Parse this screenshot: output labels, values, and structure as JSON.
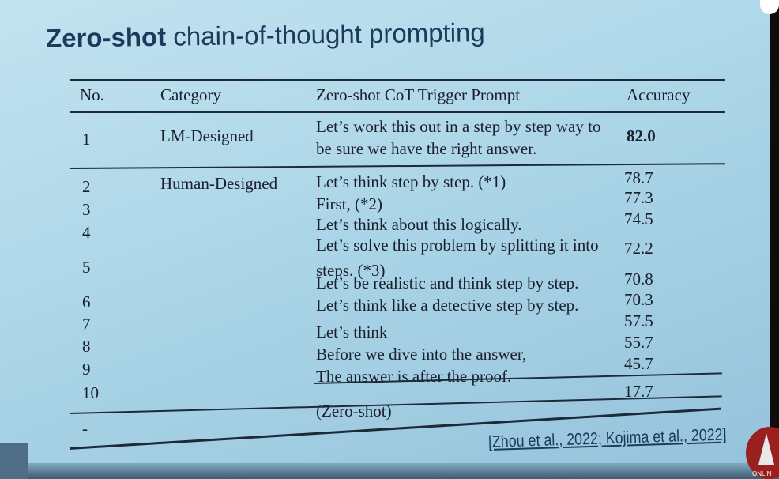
{
  "slide": {
    "title_bold": "Zero-shot",
    "title_rest": " chain-of-thought prompting",
    "citation": "[Zhou et al., 2022; Kojima et al., 2022]",
    "logo_text": "ONLINE"
  },
  "table": {
    "headers": [
      "No.",
      "Category",
      "Zero-shot CoT Trigger Prompt",
      "Accuracy"
    ],
    "rows": [
      {
        "no": "1",
        "category": "LM-Designed",
        "prompt_line1": "Let’s work this out in a step by step way to",
        "prompt_line2": "be sure we have the right answer.",
        "accuracy": "82.0"
      },
      {
        "no": "2",
        "category": "Human-Designed",
        "prompt": "Let’s think step by step. (*1)",
        "accuracy": "78.7"
      },
      {
        "no": "3",
        "prompt": "First, (*2)",
        "accuracy": "77.3"
      },
      {
        "no": "4",
        "prompt": "Let’s think about this logically.",
        "accuracy": "74.5"
      },
      {
        "no": "5",
        "prompt_line1": "Let’s solve this problem by splitting it into",
        "prompt_line2": "steps. (*3)",
        "accuracy": "72.2"
      },
      {
        "no": "6",
        "prompt": "Let’s be realistic and think step by step.",
        "accuracy": "70.8"
      },
      {
        "no": "7",
        "prompt": "Let’s think like a detective step by step.",
        "accuracy": "70.3"
      },
      {
        "no": "8",
        "prompt": "Let’s think",
        "accuracy": "57.5"
      },
      {
        "no": "9",
        "prompt": "Before we dive into the answer,",
        "accuracy": "55.7"
      },
      {
        "no": "10",
        "prompt": "The answer is after the proof.",
        "accuracy": "45.7"
      },
      {
        "no": "-",
        "prompt": "(Zero-shot)",
        "accuracy": "17.7"
      }
    ]
  }
}
